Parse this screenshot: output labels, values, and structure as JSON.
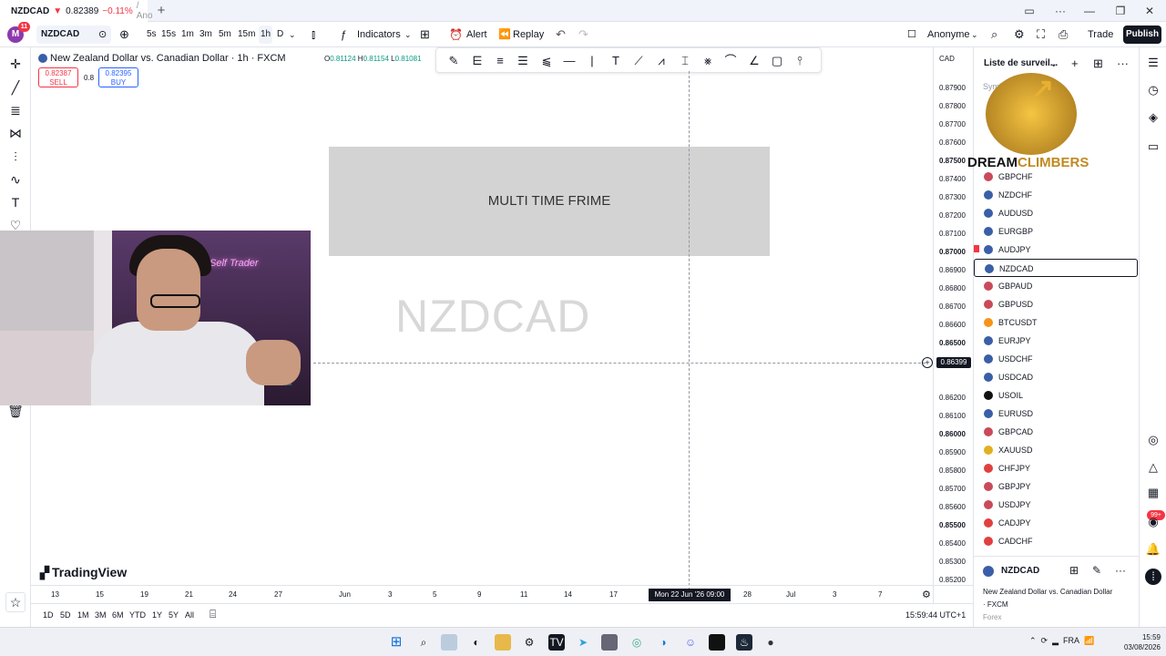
{
  "tab": {
    "symbol": "NZDCAD",
    "arrow": "▼",
    "price": "0.82389",
    "change": "−0.11%",
    "rest": "/ Ano"
  },
  "toolbar": {
    "symbol": "NZDCAD",
    "intervals": [
      "5s",
      "15s",
      "1m",
      "3m",
      "5m",
      "15m",
      "1h",
      "D"
    ],
    "indicators": "Indicators",
    "alert": "Alert",
    "replay": "Replay",
    "anonymous": "Anonyme",
    "trade": "Trade",
    "publish": "Publish",
    "avatar": "M",
    "badge": "11"
  },
  "chart": {
    "title": "New Zealand Dollar vs. Canadian Dollar · 1h · FXCM",
    "ohlc": {
      "o": "0.81124",
      "h": "0.81154",
      "l": "0.81081"
    },
    "sell_price": "0.82387",
    "sell_label": "SELL",
    "spread": "0.8",
    "buy_price": "0.82395",
    "buy_label": "BUY",
    "overlay_text": "MULTI TIME FRIME",
    "watermark": "NZDCAD",
    "currency": "CAD",
    "current_price": "0.86399",
    "crosshair_time": "Mon 22 Jun '26   09:00",
    "tv_brand": "TradingView",
    "price_ticks": [
      "0.87900",
      "0.87800",
      "0.87700",
      "0.87600",
      "0.87500",
      "0.87400",
      "0.87300",
      "0.87200",
      "0.87100",
      "0.87000",
      "0.86900",
      "0.86800",
      "0.86700",
      "0.86600",
      "0.86500",
      "0.86200",
      "0.86100",
      "0.86000",
      "0.85900",
      "0.85800",
      "0.85700",
      "0.85600",
      "0.85500",
      "0.85400",
      "0.85300",
      "0.85200"
    ],
    "time_ticks": [
      "13",
      "15",
      "19",
      "21",
      "24",
      "27",
      "Jun",
      "3",
      "5",
      "9",
      "11",
      "14",
      "17",
      "28",
      "Jul",
      "3",
      "7"
    ],
    "ranges": [
      "1D",
      "5D",
      "1M",
      "3M",
      "6M",
      "YTD",
      "1Y",
      "5Y",
      "All"
    ],
    "clock": "15:59:44 UTC+1"
  },
  "watchlist": {
    "title": "Liste de surveil...",
    "symbol_header": "Symb",
    "items": [
      "GBPCHF",
      "NZDCHF",
      "AUDUSD",
      "EURGBP",
      "AUDJPY",
      "NZDCAD",
      "GBPAUD",
      "GBPUSD",
      "BTCUSDT",
      "EURJPY",
      "USDCHF",
      "USDCAD",
      "USOIL",
      "EURUSD",
      "GBPCAD",
      "XAUUSD",
      "CHFJPY",
      "GBPJPY",
      "USDJPY",
      "CADJPY",
      "CADCHF"
    ],
    "selected": "NZDCAD"
  },
  "logo": {
    "part1": "DREAM",
    "part2": "CLIMBERS"
  },
  "detail": {
    "symbol": "NZDCAD",
    "name": "New Zealand Dollar vs. Canadian Dollar",
    "exchange": "· FXCM",
    "category": "Forex"
  },
  "sidebar_badge": "99+",
  "taskbar": {
    "lang": "FRA",
    "time": "15:59",
    "date": "03/08/2026"
  }
}
